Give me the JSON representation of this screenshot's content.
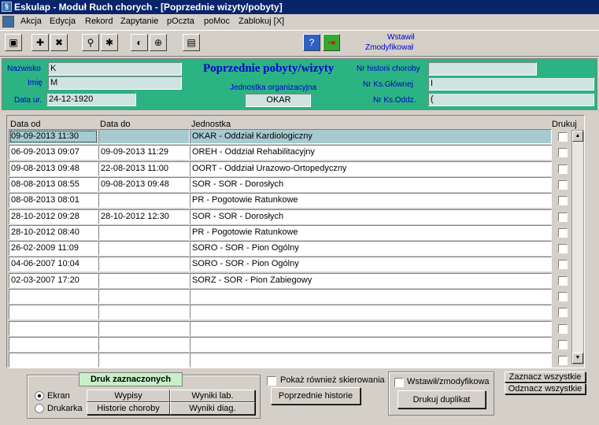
{
  "window": {
    "title": "Eskulap - Moduł Ruch chorych - [Poprzednie wizyty/pobyty]"
  },
  "menu": [
    "Akcja",
    "Edycja",
    "Rekord",
    "Zapytanie",
    "pOczta",
    "poMoc",
    "Zablokuj [X]"
  ],
  "toolbar": {
    "status_line1": "Wstawił",
    "status_line2": "Zmodyfikował"
  },
  "header": {
    "title": "Poprzednie pobyty/wizyty",
    "nazwisko_label": "Nazwisko",
    "nazwisko_value": "K",
    "imie_label": "Imię",
    "imie_value": "M",
    "data_ur_label": "Data ur.",
    "data_ur_value": "24-12-1920",
    "jednostka_label": "Jednostka organizacyjna",
    "jednostka_value": "OKAR",
    "nr_historii_label": "Nr historii choroby",
    "nr_historii_value": "",
    "nr_ks_glownej_label": "Nr Ks.Głównej",
    "nr_ks_glownej_value": "I",
    "nr_ks_oddz_label": "Nr Ks.Oddz.",
    "nr_ks_oddz_value": "("
  },
  "table": {
    "columns": [
      "Data od",
      "Data do",
      "Jednostka",
      "Drukuj"
    ],
    "rows": [
      [
        "09-09-2013 11:30",
        "",
        "OKAR - Oddział Kardiologiczny"
      ],
      [
        "06-09-2013 09:07",
        "09-09-2013 11:29",
        "OREH - Oddział Rehabilitacyjny"
      ],
      [
        "09-08-2013 09:48",
        "22-08-2013 11:00",
        "OORT - Oddział Urazowo-Ortopedyczny"
      ],
      [
        "08-08-2013 08:55",
        "09-08-2013 09:48",
        "SOR - SOR - Dorosłych"
      ],
      [
        "08-08-2013 08:01",
        "",
        "PR - Pogotowie Ratunkowe"
      ],
      [
        "28-10-2012 09:28",
        "28-10-2012 12:30",
        "SOR - SOR - Dorosłych"
      ],
      [
        "28-10-2012 08:40",
        "",
        "PR - Pogotowie Ratunkowe"
      ],
      [
        "26-02-2009 11:09",
        "",
        "SORO - SOR - Pion Ogólny"
      ],
      [
        "04-06-2007 10:04",
        "",
        "SORO - SOR - Pion Ogólny"
      ],
      [
        "02-03-2007 17:20",
        "",
        "SORZ - SOR - Pion Zabiegowy"
      ],
      [
        "",
        "",
        ""
      ],
      [
        "",
        "",
        ""
      ],
      [
        "",
        "",
        ""
      ],
      [
        "",
        "",
        ""
      ],
      [
        "",
        "",
        ""
      ]
    ]
  },
  "bottom": {
    "druk_title": "Druk zaznaczonych",
    "ekran": "Ekran",
    "drukarka": "Drukarka",
    "wypisy": "Wypisy",
    "wyniki_lab": "Wyniki lab.",
    "historie_choroby": "Historie choroby",
    "wyniki_diag": "Wyniki diag.",
    "pokaz_skierowania": "Pokaż również skierowania",
    "poprzednie_historie": "Poprzednie historie",
    "wstawil_zmodyfikowal": "Wstawił/zmodyfikowa",
    "drukuj_duplikat": "Drukuj duplikat",
    "zaznacz_wszystkie": "Zaznacz wszystkie",
    "odznacz_wszystkie": "Odznacz wszystkie"
  }
}
